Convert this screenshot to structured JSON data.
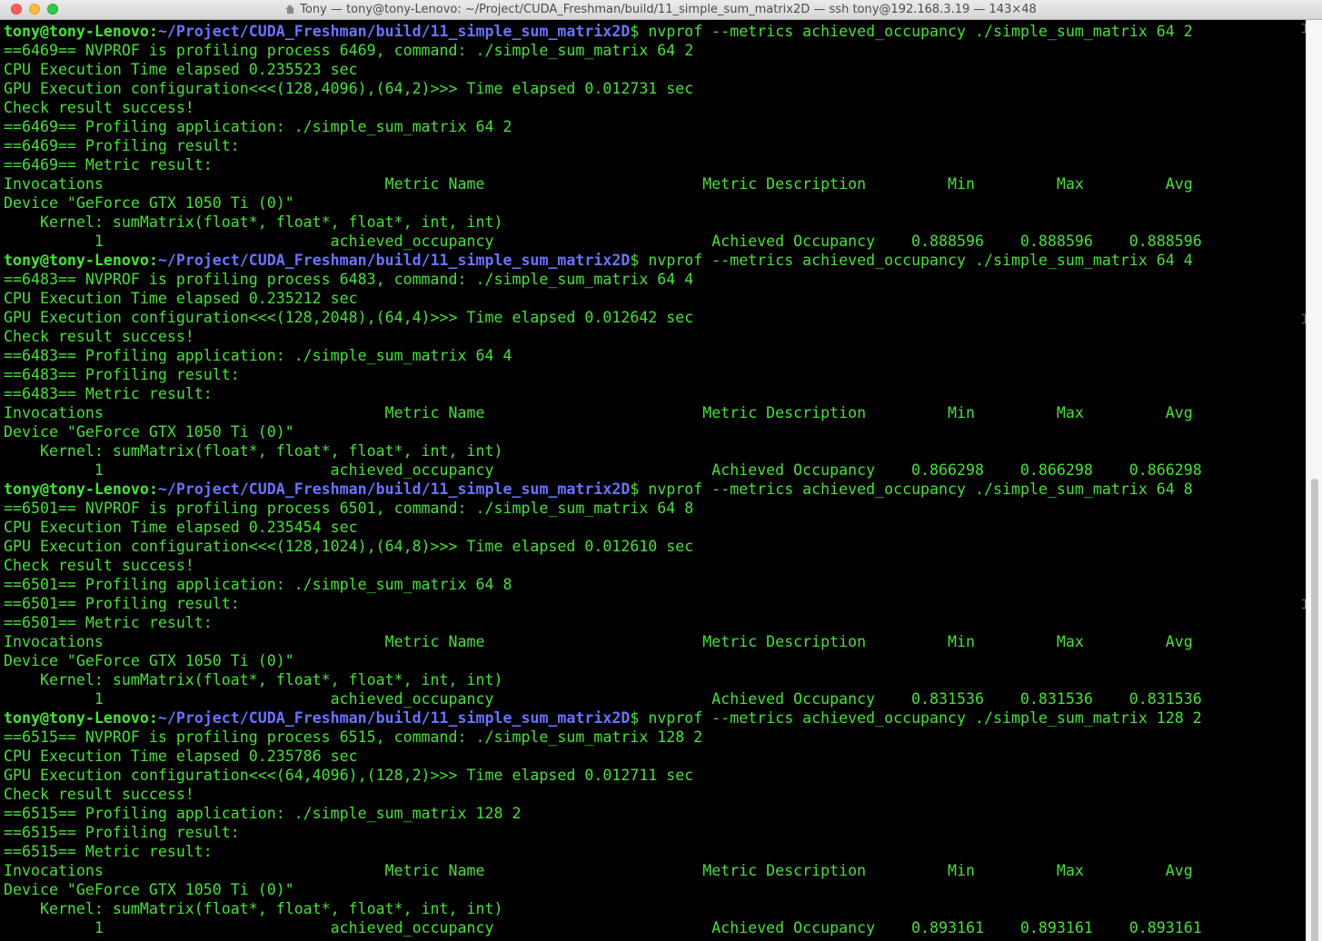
{
  "window": {
    "title": "Tony — tony@tony-Lenovo: ~/Project/CUDA_Freshman/build/11_simple_sum_matrix2D — ssh tony@192.168.3.19 — 143×48",
    "icon": "home-icon"
  },
  "colors": {
    "background": "#000000",
    "text": "#47e038",
    "path": "#6a73ff"
  },
  "terminal": {
    "prompt_user": "tony@tony-Lenovo",
    "prompt_sep": ":",
    "prompt_path": "~/Project/CUDA_Freshman/build/11_simple_sum_matrix2D",
    "prompt_end": "$",
    "lines": [
      {
        "type": "prompt",
        "cmd": " nvprof --metrics achieved_occupancy ./simple_sum_matrix 64 2"
      },
      {
        "type": "text",
        "text": "==6469== NVPROF is profiling process 6469, command: ./simple_sum_matrix 64 2"
      },
      {
        "type": "text",
        "text": "CPU Execution Time elapsed 0.235523 sec"
      },
      {
        "type": "text",
        "text": "GPU Execution configuration<<<(128,4096),(64,2)>>> Time elapsed 0.012731 sec"
      },
      {
        "type": "text",
        "text": "Check result success!"
      },
      {
        "type": "text",
        "text": "==6469== Profiling application: ./simple_sum_matrix 64 2"
      },
      {
        "type": "text",
        "text": "==6469== Profiling result:"
      },
      {
        "type": "text",
        "text": "==6469== Metric result:"
      },
      {
        "type": "text",
        "text": "Invocations                               Metric Name                        Metric Description         Min         Max         Avg"
      },
      {
        "type": "text",
        "text": "Device \"GeForce GTX 1050 Ti (0)\""
      },
      {
        "type": "text",
        "text": "    Kernel: sumMatrix(float*, float*, float*, int, int)"
      },
      {
        "type": "text",
        "text": "          1                         achieved_occupancy                        Achieved Occupancy    0.888596    0.888596    0.888596"
      },
      {
        "type": "prompt",
        "cmd": " nvprof --metrics achieved_occupancy ./simple_sum_matrix 64 4"
      },
      {
        "type": "text",
        "text": "==6483== NVPROF is profiling process 6483, command: ./simple_sum_matrix 64 4"
      },
      {
        "type": "text",
        "text": "CPU Execution Time elapsed 0.235212 sec"
      },
      {
        "type": "text",
        "text": "GPU Execution configuration<<<(128,2048),(64,4)>>> Time elapsed 0.012642 sec"
      },
      {
        "type": "text",
        "text": "Check result success!"
      },
      {
        "type": "text",
        "text": "==6483== Profiling application: ./simple_sum_matrix 64 4"
      },
      {
        "type": "text",
        "text": "==6483== Profiling result:"
      },
      {
        "type": "text",
        "text": "==6483== Metric result:"
      },
      {
        "type": "text",
        "text": "Invocations                               Metric Name                        Metric Description         Min         Max         Avg"
      },
      {
        "type": "text",
        "text": "Device \"GeForce GTX 1050 Ti (0)\""
      },
      {
        "type": "text",
        "text": "    Kernel: sumMatrix(float*, float*, float*, int, int)"
      },
      {
        "type": "text",
        "text": "          1                         achieved_occupancy                        Achieved Occupancy    0.866298    0.866298    0.866298"
      },
      {
        "type": "prompt",
        "cmd": " nvprof --metrics achieved_occupancy ./simple_sum_matrix 64 8"
      },
      {
        "type": "text",
        "text": "==6501== NVPROF is profiling process 6501, command: ./simple_sum_matrix 64 8"
      },
      {
        "type": "text",
        "text": "CPU Execution Time elapsed 0.235454 sec"
      },
      {
        "type": "text",
        "text": "GPU Execution configuration<<<(128,1024),(64,8)>>> Time elapsed 0.012610 sec"
      },
      {
        "type": "text",
        "text": "Check result success!"
      },
      {
        "type": "text",
        "text": "==6501== Profiling application: ./simple_sum_matrix 64 8"
      },
      {
        "type": "text",
        "text": "==6501== Profiling result:"
      },
      {
        "type": "text",
        "text": "==6501== Metric result:"
      },
      {
        "type": "text",
        "text": "Invocations                               Metric Name                        Metric Description         Min         Max         Avg"
      },
      {
        "type": "text",
        "text": "Device \"GeForce GTX 1050 Ti (0)\""
      },
      {
        "type": "text",
        "text": "    Kernel: sumMatrix(float*, float*, float*, int, int)"
      },
      {
        "type": "text",
        "text": "          1                         achieved_occupancy                        Achieved Occupancy    0.831536    0.831536    0.831536"
      },
      {
        "type": "prompt",
        "cmd": " nvprof --metrics achieved_occupancy ./simple_sum_matrix 128 2"
      },
      {
        "type": "text",
        "text": "==6515== NVPROF is profiling process 6515, command: ./simple_sum_matrix 128 2"
      },
      {
        "type": "text",
        "text": "CPU Execution Time elapsed 0.235786 sec"
      },
      {
        "type": "text",
        "text": "GPU Execution configuration<<<(64,4096),(128,2)>>> Time elapsed 0.012711 sec"
      },
      {
        "type": "text",
        "text": "Check result success!"
      },
      {
        "type": "text",
        "text": "==6515== Profiling application: ./simple_sum_matrix 128 2"
      },
      {
        "type": "text",
        "text": "==6515== Profiling result:"
      },
      {
        "type": "text",
        "text": "==6515== Metric result:"
      },
      {
        "type": "text",
        "text": "Invocations                               Metric Name                        Metric Description         Min         Max         Avg"
      },
      {
        "type": "text",
        "text": "Device \"GeForce GTX 1050 Ti (0)\""
      },
      {
        "type": "text",
        "text": "    Kernel: sumMatrix(float*, float*, float*, int, int)"
      },
      {
        "type": "text",
        "text": "          1                         achieved_occupancy                        Achieved Occupancy    0.893161    0.893161    0.893161"
      }
    ]
  }
}
